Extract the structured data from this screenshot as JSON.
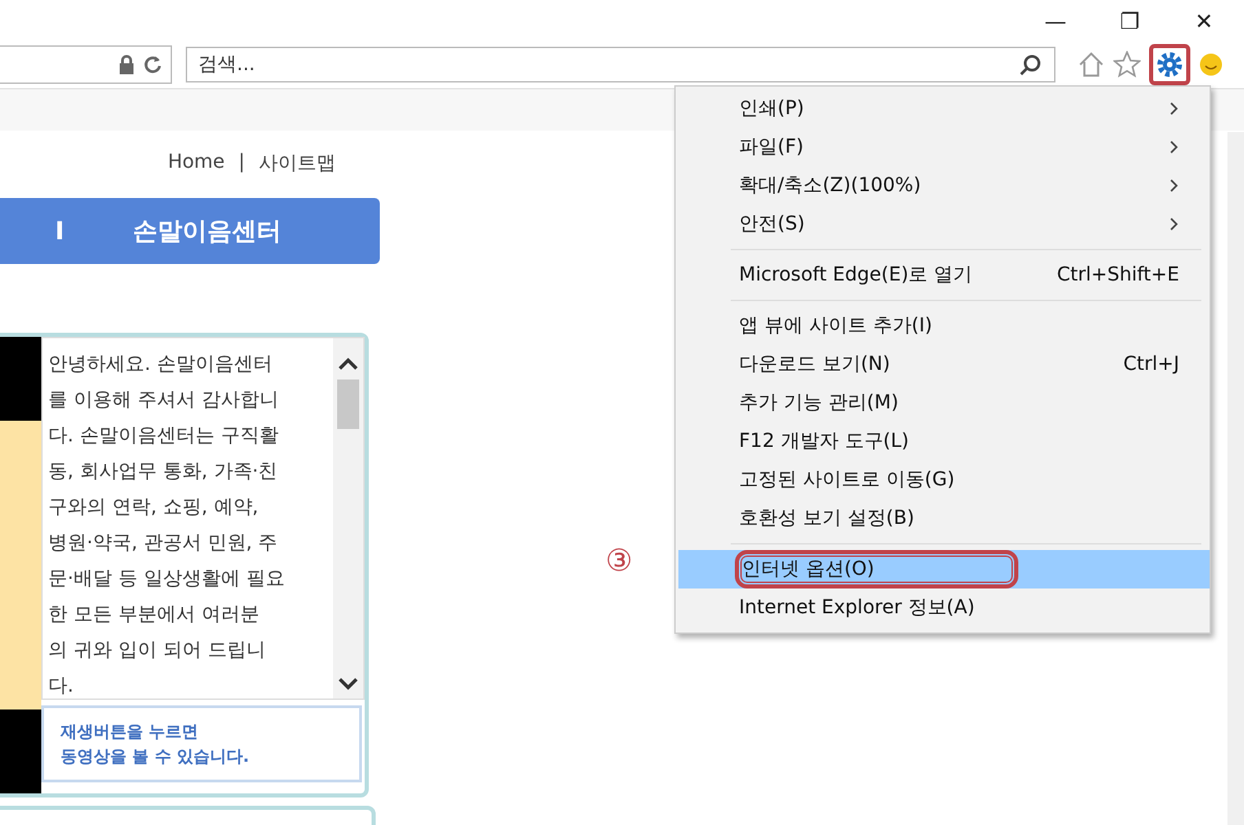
{
  "window_controls": {
    "minimize": "—",
    "restore": "❐",
    "close": "✕"
  },
  "address_bar": {
    "search_placeholder": "검색..."
  },
  "top_links": [
    "Home",
    "|",
    "사이트맵"
  ],
  "page_banner": {
    "marker": "I",
    "title": "손말이음센터"
  },
  "intro": {
    "lines": [
      "안녕하세요. 손말이음센터",
      "를 이용해 주셔서 감사합니",
      "다. 손말이음센터는 구직활",
      "동, 회사업무 통화, 가족·친",
      "구와의 연락, 쇼핑, 예약,",
      "병원·약국, 관공서 민원, 주",
      "문·배달 등 일상생활에 필요",
      "한 모든 부분에서 여러분",
      "의 귀와 입이 되어 드립니",
      "다."
    ],
    "notice": [
      "재생버튼을 누르면",
      "동영상을 볼 수 있습니다."
    ]
  },
  "step_marker": "③",
  "tools_menu": {
    "groups": [
      [
        {
          "kind": "submenu",
          "label": "인쇄(P)",
          "selected": false
        },
        {
          "kind": "submenu",
          "label": "파일(F)",
          "selected": false
        },
        {
          "kind": "submenu",
          "label": "확대/축소(Z)(100%)",
          "selected": false
        },
        {
          "kind": "submenu",
          "label": "안전(S)",
          "selected": false
        }
      ],
      [
        {
          "kind": "shortcut",
          "label": "Microsoft Edge(E)로 열기",
          "shortcut": "Ctrl+Shift+E",
          "selected": false
        }
      ],
      [
        {
          "kind": "plain",
          "label": "앱 뷰에 사이트 추가(I)",
          "selected": false
        },
        {
          "kind": "shortcut",
          "label": "다운로드 보기(N)",
          "shortcut": "Ctrl+J",
          "selected": false
        },
        {
          "kind": "plain",
          "label": "추가 기능 관리(M)",
          "selected": false
        },
        {
          "kind": "plain",
          "label": "F12 개발자 도구(L)",
          "selected": false
        },
        {
          "kind": "plain",
          "label": "고정된 사이트로 이동(G)",
          "selected": false
        },
        {
          "kind": "plain",
          "label": "호환성 보기 설정(B)",
          "selected": false
        }
      ],
      [
        {
          "kind": "plain",
          "label": "인터넷 옵션(O)",
          "selected": true
        },
        {
          "kind": "plain",
          "label": "Internet Explorer 정보(A)",
          "selected": false
        }
      ]
    ]
  }
}
